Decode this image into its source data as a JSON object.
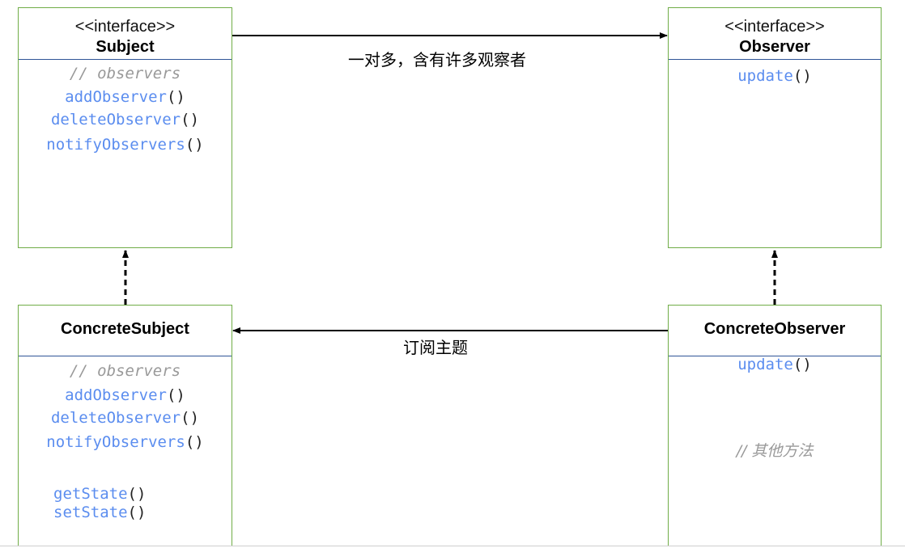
{
  "subject": {
    "stereotype": "<<interface>>",
    "name": "Subject",
    "comment": "// observers",
    "methods": [
      {
        "name": "addObserver",
        "parens": "()"
      },
      {
        "name": "deleteObserver",
        "parens": "()"
      },
      {
        "name": "notifyObservers",
        "parens": "()"
      }
    ]
  },
  "observer": {
    "stereotype": "<<interface>>",
    "name": "Observer",
    "methods": [
      {
        "name": "update",
        "parens": "()"
      }
    ]
  },
  "concrete_subject": {
    "name": "ConcreteSubject",
    "comment": "// observers",
    "methods": [
      {
        "name": "addObserver",
        "parens": "()"
      },
      {
        "name": "deleteObserver",
        "parens": "()"
      },
      {
        "name": "notifyObservers",
        "parens": "()"
      },
      {
        "name": "getState",
        "parens": "()"
      },
      {
        "name": "setState",
        "parens": "()"
      }
    ]
  },
  "concrete_observer": {
    "name": "ConcreteObserver",
    "methods": [
      {
        "name": "update",
        "parens": "()"
      }
    ],
    "comment": "// 其他方法"
  },
  "edges": {
    "subject_to_observer": "一对多，含有许多观察者",
    "observer_to_subject": "订阅主题"
  }
}
